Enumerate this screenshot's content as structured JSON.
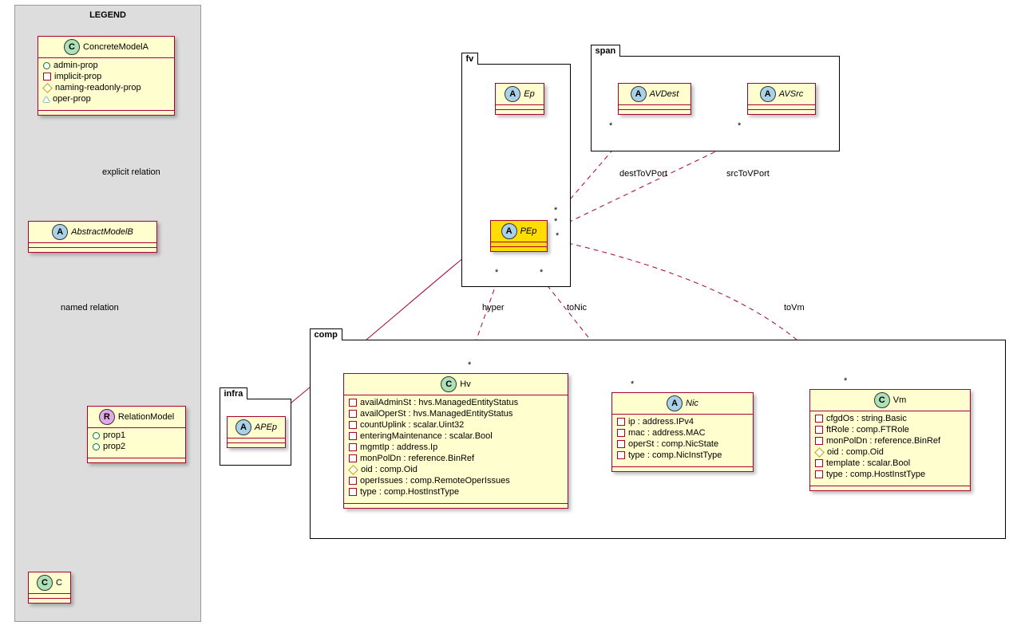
{
  "legend": {
    "title": "LEGEND",
    "concrete": {
      "name": "ConcreteModelA",
      "props": [
        "admin-prop",
        "implicit-prop",
        "naming-readonly-prop",
        "oper-prop"
      ]
    },
    "abstract": {
      "name": "AbstractModelB"
    },
    "relation": {
      "name": "RelationModel",
      "props": [
        "prop1",
        "prop2"
      ]
    },
    "small": {
      "name": "C"
    },
    "label_explicit": "explicit relation",
    "label_named": "named relation"
  },
  "pkg": {
    "fv": "fv",
    "span": "span",
    "infra": "infra",
    "comp": "comp"
  },
  "fv": {
    "ep": "Ep",
    "pep": "PEp"
  },
  "span": {
    "avdest": "AVDest",
    "avsrc": "AVSrc"
  },
  "infra": {
    "apep": "APEp"
  },
  "comp": {
    "hv": {
      "name": "Hv",
      "props": [
        "availAdminSt : hvs.ManagedEntityStatus",
        "availOperSt : hvs.ManagedEntityStatus",
        "countUplink : scalar.Uint32",
        "enteringMaintenance : scalar.Bool",
        "mgmtIp : address.Ip",
        "monPolDn : reference.BinRef",
        "oid : comp.Oid",
        "operIssues : comp.RemoteOperIssues",
        "type : comp.HostInstType"
      ],
      "markers": [
        "sq",
        "sq",
        "sq",
        "sq",
        "sq",
        "sq",
        "dia",
        "sq",
        "sq"
      ]
    },
    "nic": {
      "name": "Nic",
      "props": [
        "ip : address.IPv4",
        "mac : address.MAC",
        "operSt : comp.NicState",
        "type : comp.NicInstType"
      ]
    },
    "vm": {
      "name": "Vm",
      "props": [
        "cfgdOs : string.Basic",
        "ftRole : comp.FTRole",
        "monPolDn : reference.BinRef",
        "oid : comp.Oid",
        "template : scalar.Bool",
        "type : comp.HostInstType"
      ],
      "markers": [
        "sq",
        "sq",
        "sq",
        "dia",
        "sq",
        "sq"
      ]
    }
  },
  "rel": {
    "destToVPort": "destToVPort",
    "srcToVPort": "srcToVPort",
    "hyper": "hyper",
    "toNic": "toNic",
    "toVm": "toVm"
  },
  "star": "*"
}
